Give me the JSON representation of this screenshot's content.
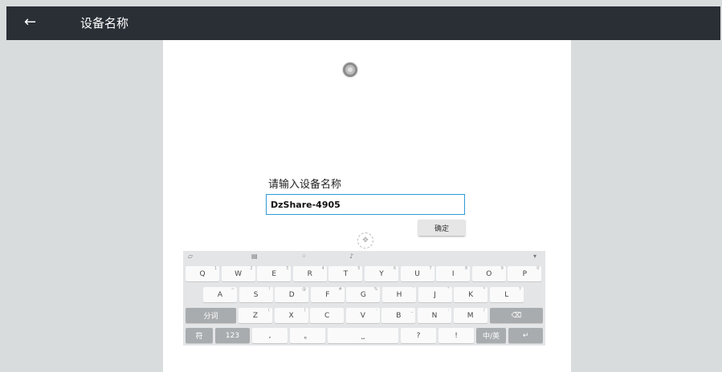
{
  "header": {
    "back_icon": "arrow-left-icon",
    "title": "设备名称"
  },
  "dialog": {
    "prompt": "请输入设备名称",
    "device_name": "DzShare-4905",
    "confirm_label": "确定"
  },
  "keyboard": {
    "toolbar": [
      "clipboard-icon",
      "keyboard-layout-icon",
      "cursor-move-icon",
      "microphone-icon",
      "collapse-keyboard-icon"
    ],
    "row1": [
      {
        "k": "Q",
        "s": "1"
      },
      {
        "k": "W",
        "s": "2"
      },
      {
        "k": "E",
        "s": "3"
      },
      {
        "k": "R",
        "s": "4"
      },
      {
        "k": "T",
        "s": "5"
      },
      {
        "k": "Y",
        "s": "6"
      },
      {
        "k": "U",
        "s": "7"
      },
      {
        "k": "I",
        "s": "8"
      },
      {
        "k": "O",
        "s": "9"
      },
      {
        "k": "P",
        "s": "0"
      }
    ],
    "row2": [
      {
        "k": "A",
        "s": "~"
      },
      {
        "k": "S",
        "s": "!"
      },
      {
        "k": "D",
        "s": "@"
      },
      {
        "k": "F",
        "s": "#"
      },
      {
        "k": "G",
        "s": "%"
      },
      {
        "k": "H",
        "s": "'"
      },
      {
        "k": "J",
        "s": "\""
      },
      {
        "k": "K",
        "s": "*"
      },
      {
        "k": "L",
        "s": "?"
      }
    ],
    "row3_left": "分词",
    "row3": [
      {
        "k": "Z",
        "s": "("
      },
      {
        "k": "X",
        "s": ")"
      },
      {
        "k": "C",
        "s": ""
      },
      {
        "k": "V",
        "s": "-"
      },
      {
        "k": "B",
        "s": "_"
      },
      {
        "k": "N",
        "s": ":"
      },
      {
        "k": "M",
        "s": "/"
      }
    ],
    "row4": {
      "symbols": "符",
      "numbers": "123",
      "comma": ",",
      "period": "。",
      "space": "⎵",
      "question": "?",
      "exclaim": "!",
      "lang": "中/英",
      "enter": "↵",
      "backspace": "⌫"
    }
  }
}
